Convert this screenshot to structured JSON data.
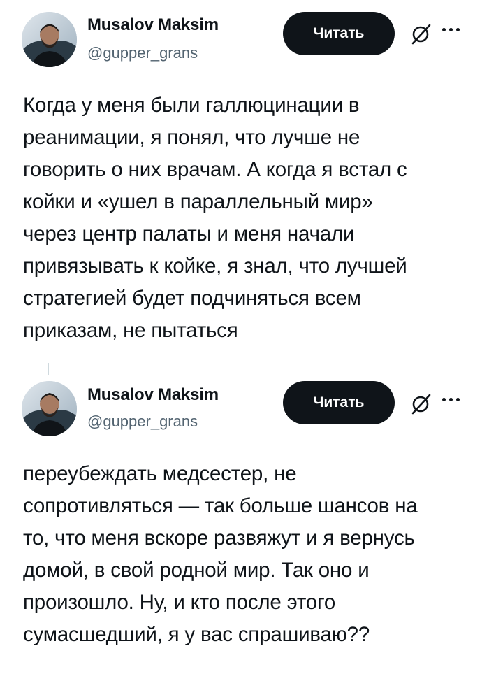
{
  "tweets": [
    {
      "author": {
        "display_name": "Musalov Maksim",
        "handle": "@gupper_grans",
        "avatar_icon": "avatar-photo"
      },
      "follow_label": "Читать",
      "grok_icon": "grok-icon",
      "more_icon": "more-dots-icon",
      "text_lines": [
        "Когда у меня были галлюцинации в",
        "реанимации, я понял, что лучше не",
        "говорить о них врачам. А когда я встал с",
        "койки и «ушел в параллельный мир»",
        "через центр палаты и меня начали",
        "привязывать к койке, я знал, что лучшей",
        "стратегией будет подчиняться всем",
        "приказам, не пытаться"
      ]
    },
    {
      "author": {
        "display_name": "Musalov Maksim",
        "handle": "@gupper_grans",
        "avatar_icon": "avatar-photo"
      },
      "follow_label": "Читать",
      "grok_icon": "grok-icon",
      "more_icon": "more-dots-icon",
      "text_lines": [
        "переубеждать медсестер, не",
        "сопротивляться — так больше шансов на",
        "то, что меня вскоре развяжут и я вернусь",
        "домой, в свой родной мир. Так оно и",
        "произошло. Ну, и кто после этого",
        "сумасшедший, я у вас спрашиваю??"
      ]
    }
  ],
  "colors": {
    "text": "#0f1419",
    "secondary_text": "#536471",
    "button_bg": "#0f1419",
    "button_text": "#ffffff",
    "thread_line": "#cfd9de"
  }
}
